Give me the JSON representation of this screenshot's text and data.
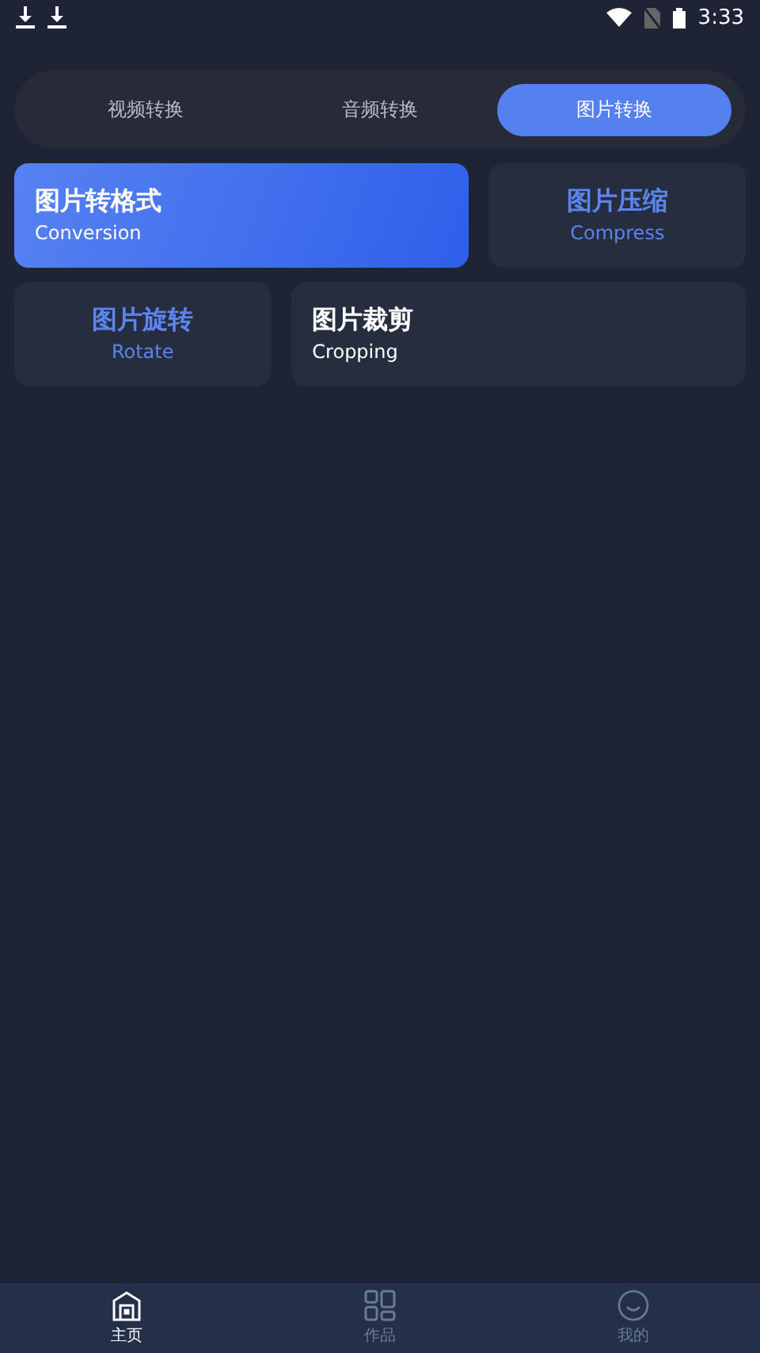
{
  "status_bar": {
    "time": "3:33"
  },
  "tabs": [
    {
      "label": "视频转换",
      "selected": false
    },
    {
      "label": "音频转换",
      "selected": false
    },
    {
      "label": "图片转换",
      "selected": true
    }
  ],
  "card_rows": [
    [
      {
        "title": "图片转格式",
        "subtitle": "Conversion",
        "selected": true,
        "accent": false,
        "wide": true
      },
      {
        "title": "图片压缩",
        "subtitle": "Compress",
        "selected": false,
        "accent": true,
        "wide": false
      }
    ],
    [
      {
        "title": "图片旋转",
        "subtitle": "Rotate",
        "selected": false,
        "accent": true,
        "wide": false
      },
      {
        "title": "图片裁剪",
        "subtitle": "Cropping",
        "selected": false,
        "accent": false,
        "wide": true
      }
    ]
  ],
  "nav": [
    {
      "label": "主页",
      "kind": "home",
      "selected": true
    },
    {
      "label": "作品",
      "kind": "works",
      "selected": false
    },
    {
      "label": "我的",
      "kind": "me",
      "selected": false
    }
  ]
}
